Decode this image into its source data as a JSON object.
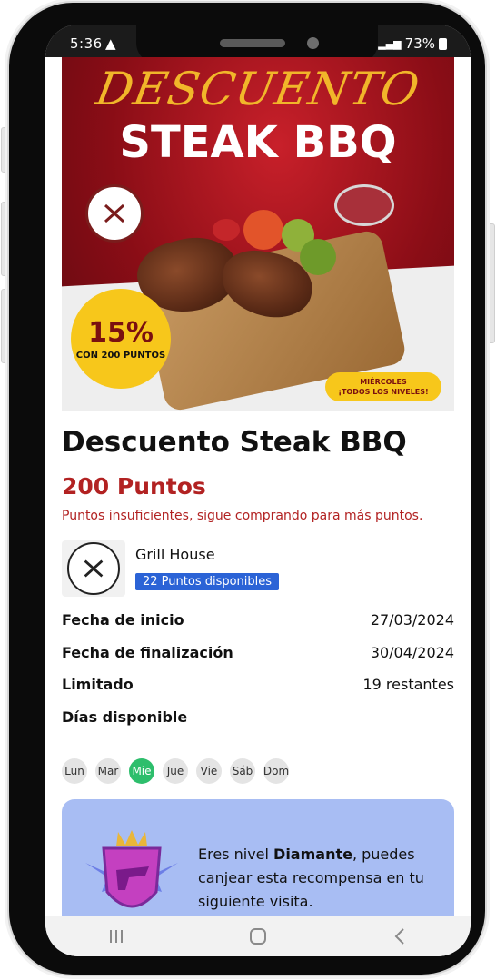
{
  "status_bar": {
    "time": "5:36",
    "battery": "73%"
  },
  "banner": {
    "script_title": "DESCUENTO",
    "big_title": "STEAK BBQ",
    "percent": "15%",
    "percent_sub": "CON 200 PUNTOS",
    "day_line1": "MIÉRCOLES",
    "day_line2": "¡TODOS LOS NIVELES!"
  },
  "reward": {
    "title": "Descuento Steak BBQ",
    "points": "200 Puntos",
    "warning": "Puntos insuficientes, sigue comprando para más puntos."
  },
  "store": {
    "name": "Grill House",
    "available_points": "22 Puntos disponibles"
  },
  "details": {
    "start_label": "Fecha de inicio",
    "start_value": "27/03/2024",
    "end_label": "Fecha de finalización",
    "end_value": "30/04/2024",
    "limited_label": "Limitado",
    "limited_value": "19 restantes",
    "days_label": "Días disponible"
  },
  "days": [
    {
      "label": "Lun",
      "active": false
    },
    {
      "label": "Mar",
      "active": false
    },
    {
      "label": "Mie",
      "active": true
    },
    {
      "label": "Jue",
      "active": false
    },
    {
      "label": "Vie",
      "active": false
    },
    {
      "label": "Sáb",
      "active": false
    },
    {
      "label": "Dom",
      "active": false
    }
  ],
  "level_card": {
    "text_prefix": "Eres nivel ",
    "level": "Diamante",
    "text_suffix": ", puedes canjear esta recompensa en tu siguiente visita."
  },
  "navbar": {
    "recents_icon": "recents-icon",
    "home_icon": "home-icon",
    "back_icon": "back-icon"
  },
  "colors": {
    "accent_red": "#b22222",
    "badge_blue": "#2b63d6",
    "active_day_green": "#2dbe6c",
    "level_card_bg": "#a8bdf3"
  }
}
